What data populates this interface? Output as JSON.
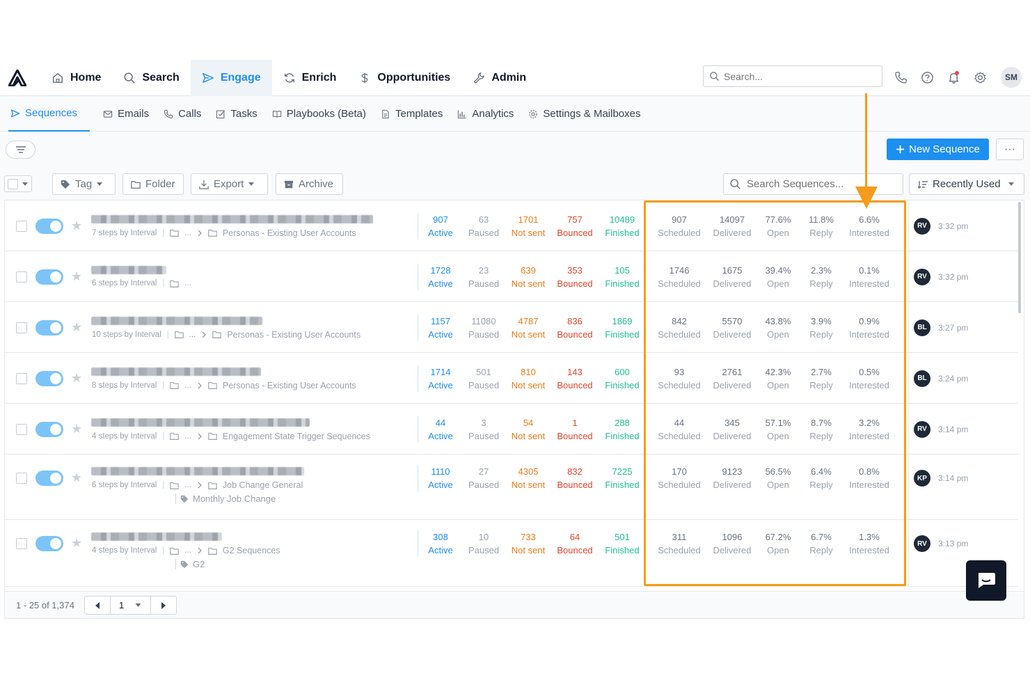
{
  "nav": {
    "items": [
      {
        "label": "Home",
        "icon": "home-icon"
      },
      {
        "label": "Search",
        "icon": "search-icon"
      },
      {
        "label": "Engage",
        "icon": "send-icon",
        "active": true
      },
      {
        "label": "Enrich",
        "icon": "refresh-icon"
      },
      {
        "label": "Opportunities",
        "icon": "dollar-icon"
      },
      {
        "label": "Admin",
        "icon": "wrench-icon"
      }
    ],
    "search_placeholder": "Search...",
    "user_initials": "SM"
  },
  "subnav": {
    "items": [
      {
        "label": "Sequences",
        "active": true
      },
      {
        "label": "Emails"
      },
      {
        "label": "Calls"
      },
      {
        "label": "Tasks"
      },
      {
        "label": "Playbooks (Beta)"
      },
      {
        "label": "Templates"
      },
      {
        "label": "Analytics"
      },
      {
        "label": "Settings & Mailboxes"
      }
    ]
  },
  "toolbar": {
    "new_sequence": "New Sequence",
    "more": "···",
    "tag": "Tag",
    "folder": "Folder",
    "export": "Export",
    "archive": "Archive",
    "search_placeholder": "Search Sequences...",
    "sort": "Recently Used"
  },
  "labels": {
    "active": "Active",
    "paused": "Paused",
    "not_sent": "Not sent",
    "bounced": "Bounced",
    "finished": "Finished",
    "scheduled": "Scheduled",
    "delivered": "Delivered",
    "open": "Open",
    "reply": "Reply",
    "interested": "Interested",
    "ellipsis": "...",
    "sep": "|"
  },
  "rows": [
    {
      "steps": "7 steps by Interval",
      "folder": "Personas - Existing User Accounts",
      "tag": "",
      "active": "907",
      "paused": "63",
      "not_sent": "1701",
      "bounced": "757",
      "finished": "10489",
      "scheduled": "907",
      "delivered": "14097",
      "open": "77.6%",
      "reply": "11.8%",
      "interested": "6.6%",
      "owner": "RV",
      "time": "3:32 pm"
    },
    {
      "steps": "6 steps by Interval",
      "folder": "",
      "tag": "",
      "active": "1728",
      "paused": "23",
      "not_sent": "639",
      "bounced": "353",
      "finished": "105",
      "scheduled": "1746",
      "delivered": "1675",
      "open": "39.4%",
      "reply": "2.3%",
      "interested": "0.1%",
      "owner": "RV",
      "time": "3:32 pm"
    },
    {
      "steps": "10 steps by Interval",
      "folder": "Personas - Existing User Accounts",
      "tag": "",
      "active": "1157",
      "paused": "11080",
      "not_sent": "4787",
      "bounced": "836",
      "finished": "1869",
      "scheduled": "842",
      "delivered": "5570",
      "open": "43.8%",
      "reply": "3.9%",
      "interested": "0.9%",
      "owner": "BL",
      "time": "3:27 pm"
    },
    {
      "steps": "8 steps by Interval",
      "folder": "Personas - Existing User Accounts",
      "tag": "",
      "active": "1714",
      "paused": "501",
      "not_sent": "810",
      "bounced": "143",
      "finished": "600",
      "scheduled": "93",
      "delivered": "2761",
      "open": "42.3%",
      "reply": "2.7%",
      "interested": "0.5%",
      "owner": "BL",
      "time": "3:24 pm"
    },
    {
      "steps": "4 steps by Interval",
      "folder": "Engagement State Trigger Sequences",
      "tag": "",
      "active": "44",
      "paused": "3",
      "not_sent": "54",
      "bounced": "1",
      "finished": "288",
      "scheduled": "44",
      "delivered": "345",
      "open": "57.1%",
      "reply": "8.7%",
      "interested": "3.2%",
      "owner": "RV",
      "time": "3:14 pm"
    },
    {
      "steps": "6 steps by Interval",
      "folder": "Job Change General",
      "tag": "Monthly Job Change",
      "active": "1110",
      "paused": "27",
      "not_sent": "4305",
      "bounced": "832",
      "finished": "7225",
      "scheduled": "170",
      "delivered": "9123",
      "open": "56.5%",
      "reply": "6.4%",
      "interested": "0.8%",
      "owner": "KP",
      "time": "3:14 pm"
    },
    {
      "steps": "4 steps by Interval",
      "folder": "G2 Sequences",
      "tag": "G2",
      "active": "308",
      "paused": "10",
      "not_sent": "733",
      "bounced": "64",
      "finished": "501",
      "scheduled": "311",
      "delivered": "1096",
      "open": "67.2%",
      "reply": "6.7%",
      "interested": "1.3%",
      "owner": "RV",
      "time": "3:13 pm"
    }
  ],
  "footer": {
    "range": "1 - 25 of 1,374",
    "page": "1"
  },
  "colors": {
    "accent": "#1d8ff0",
    "highlight": "#f59c1a",
    "not_sent": "#f07a1b",
    "bounced": "#e0452b",
    "finished": "#1fc091"
  }
}
